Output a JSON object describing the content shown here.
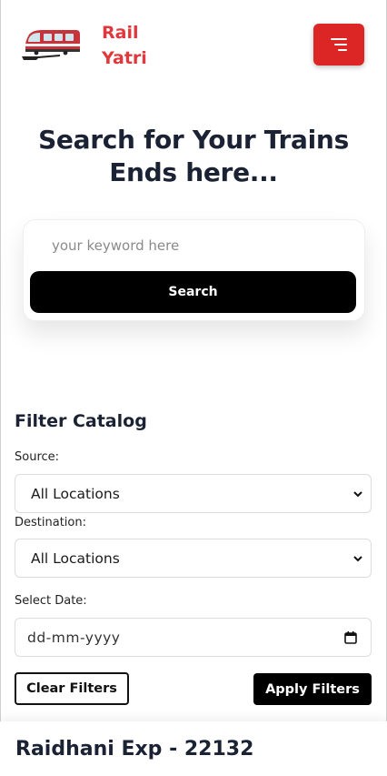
{
  "header": {
    "brand_line1": "Rail",
    "brand_line2": "Yatri",
    "menu_icon": "hamburger-menu-icon",
    "logo_icon": "train-icon",
    "accent_color": "#dc2626"
  },
  "hero": {
    "title_line1": "Search for Your Trains",
    "title_line2": "Ends here..."
  },
  "search": {
    "placeholder": "your keyword here",
    "value": "",
    "button_label": "Search"
  },
  "filters": {
    "title": "Filter Catalog",
    "source_label": "Source:",
    "source_value": "All Locations",
    "destination_label": "Destination:",
    "destination_value": "All Locations",
    "date_label": "Select Date:",
    "date_placeholder": "dd-mm-yyyy",
    "clear_label": "Clear Filters",
    "apply_label": "Apply Filters"
  },
  "results": [
    {
      "title": "Raidhani Exp - 22132"
    }
  ]
}
